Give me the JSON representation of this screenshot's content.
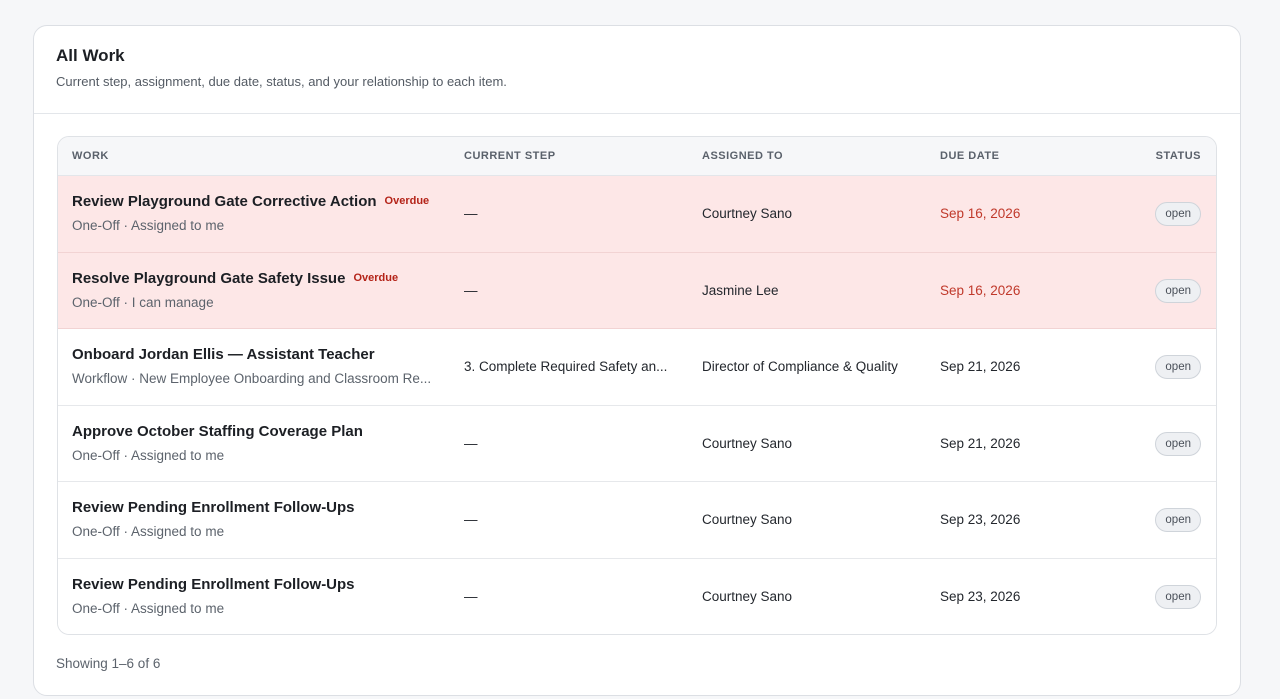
{
  "header": {
    "title": "All Work",
    "subtitle": "Current step, assignment, due date, status, and your relationship to each item."
  },
  "table": {
    "columns": [
      "WORK",
      "CURRENT STEP",
      "ASSIGNED TO",
      "DUE DATE",
      "STATUS"
    ],
    "rows": [
      {
        "title": "Review Playground Gate Corrective Action",
        "badge": "Overdue",
        "sub": "One-Off · Assigned to me",
        "step": "—",
        "assignee": "Courtney Sano",
        "due": "Sep 16, 2026",
        "status": "open"
      },
      {
        "title": "Resolve Playground Gate Safety Issue",
        "badge": "Overdue",
        "sub": "One-Off · I can manage",
        "step": "—",
        "assignee": "Jasmine Lee",
        "due": "Sep 16, 2026",
        "status": "open"
      },
      {
        "title": "Onboard Jordan Ellis — Assistant Teacher",
        "badge": "",
        "sub": "Workflow · New Employee Onboarding and Classroom Re...",
        "step": "3. Complete Required Safety an...",
        "assignee": "Director of Compliance & Quality",
        "due": "Sep 21, 2026",
        "status": "open"
      },
      {
        "title": "Approve October Staffing Coverage Plan",
        "badge": "",
        "sub": "One-Off · Assigned to me",
        "step": "—",
        "assignee": "Courtney Sano",
        "due": "Sep 21, 2026",
        "status": "open"
      },
      {
        "title": "Review Pending Enrollment Follow-Ups",
        "badge": "",
        "sub": "One-Off · Assigned to me",
        "step": "—",
        "assignee": "Courtney Sano",
        "due": "Sep 23, 2026",
        "status": "open"
      },
      {
        "title": "Review Pending Enrollment Follow-Ups",
        "badge": "",
        "sub": "One-Off · Assigned to me",
        "step": "—",
        "assignee": "Courtney Sano",
        "due": "Sep 23, 2026",
        "status": "open"
      }
    ]
  },
  "footer": {
    "showing": "Showing 1–6 of 6"
  },
  "colors": {
    "overdue_row_bg": "#fde7e7",
    "overdue_text": "#c0392b",
    "badge_text": "#b42318"
  }
}
